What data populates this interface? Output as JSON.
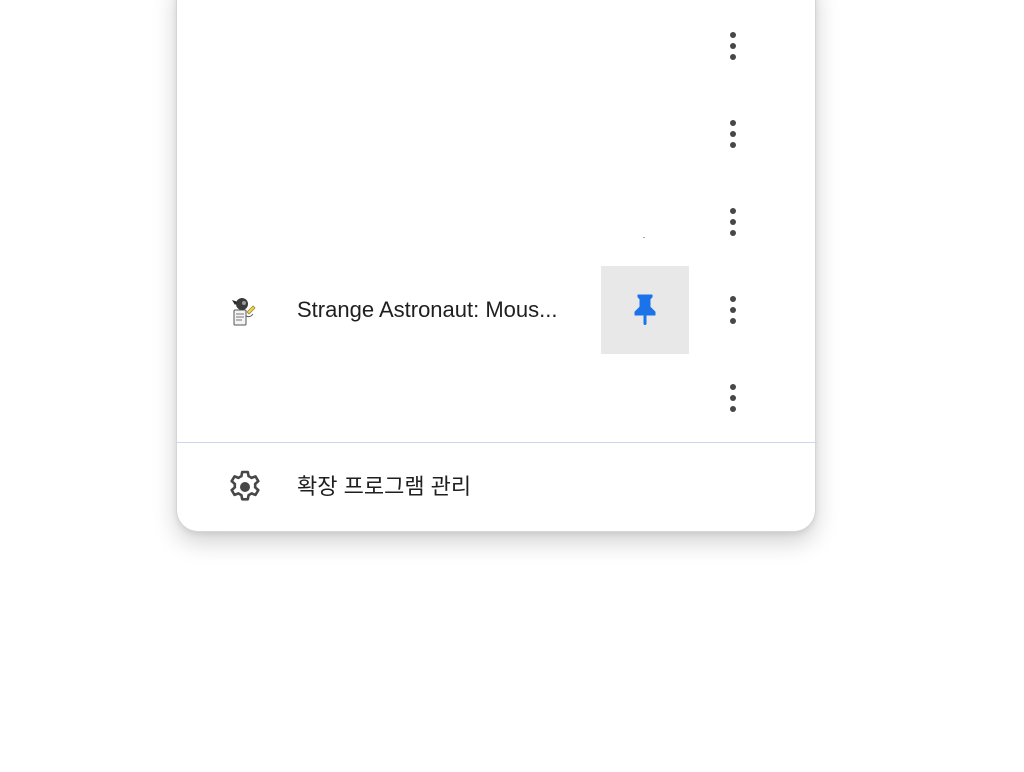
{
  "extensions_menu": {
    "items": [
      {
        "name": "",
        "pinned": false,
        "more_icon": "more-vert-icon"
      },
      {
        "name": "",
        "pinned": false,
        "more_icon": "more-vert-icon"
      },
      {
        "name": "",
        "pinned": false,
        "more_icon": "more-vert-icon"
      },
      {
        "name": "Strange Astronaut: Mous...",
        "pinned": true,
        "pin_icon": "pin-icon",
        "more_icon": "more-vert-icon"
      },
      {
        "name": "",
        "pinned": false,
        "more_icon": "more-vert-icon"
      }
    ],
    "manage": {
      "label": "확장 프로그램 관리",
      "icon": "gear-icon"
    },
    "colors": {
      "pin_active": "#1a73e8",
      "pin_hover_bg": "#e8e8e8",
      "dots": "#474747",
      "divider": "#c7d7ee"
    }
  }
}
